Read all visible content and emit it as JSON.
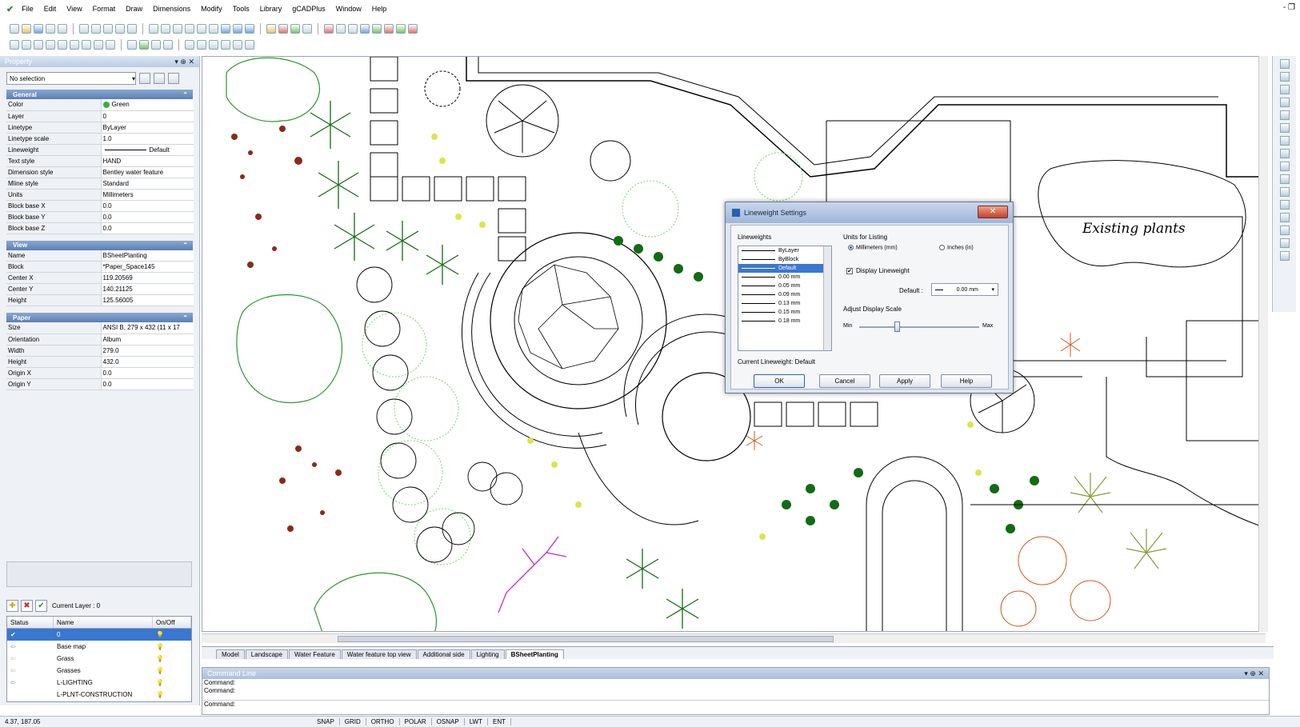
{
  "menu": {
    "items": [
      "File",
      "Edit",
      "View",
      "Format",
      "Draw",
      "Dimensions",
      "Modify",
      "Tools",
      "Library",
      "gCADPlus",
      "Window",
      "Help"
    ],
    "window_controls": "- ❐"
  },
  "property_panel": {
    "title": "Property",
    "title_controls": "▾ ⊕ ✕",
    "selection": "No selection",
    "general": {
      "header": "General",
      "rows": [
        {
          "k": "Color",
          "v": "Green"
        },
        {
          "k": "Layer",
          "v": "0"
        },
        {
          "k": "Linetype",
          "v": "ByLayer"
        },
        {
          "k": "Linetype scale",
          "v": "1.0"
        },
        {
          "k": "Lineweight",
          "v": "Default"
        },
        {
          "k": "Text style",
          "v": "HAND"
        },
        {
          "k": "Dimension style",
          "v": "Bentley water feature"
        },
        {
          "k": "Mline style",
          "v": "Standard"
        },
        {
          "k": "Units",
          "v": "Millimeters"
        },
        {
          "k": "Block base X",
          "v": "0.0"
        },
        {
          "k": "Block base Y",
          "v": "0.0"
        },
        {
          "k": "Block base Z",
          "v": "0.0"
        }
      ]
    },
    "view": {
      "header": "View",
      "rows": [
        {
          "k": "Name",
          "v": "BSheetPlanting"
        },
        {
          "k": "Block",
          "v": "*Paper_Space145"
        },
        {
          "k": "Center X",
          "v": "119.20569"
        },
        {
          "k": "Center Y",
          "v": "140.21125"
        },
        {
          "k": "Height",
          "v": "125.56005"
        }
      ]
    },
    "paper": {
      "header": "Paper",
      "rows": [
        {
          "k": "Size",
          "v": "ANSI B, 279 x 432 (11 x 17"
        },
        {
          "k": "Orientation",
          "v": "Album"
        },
        {
          "k": "Width",
          "v": "279.0"
        },
        {
          "k": "Height",
          "v": "432.0"
        },
        {
          "k": "Origin X",
          "v": "0.0"
        },
        {
          "k": "Origin Y",
          "v": "0.0"
        }
      ]
    }
  },
  "layers": {
    "current_layer_label": "Current Layer : 0",
    "columns": [
      "Status",
      "Name",
      "On/Off"
    ],
    "rows": [
      {
        "status": "✔",
        "name": "0",
        "selected": true
      },
      {
        "status": "",
        "name": "Base map",
        "selected": false
      },
      {
        "status": "",
        "name": "Grass",
        "selected": false
      },
      {
        "status": "",
        "name": "Grasses",
        "selected": false
      },
      {
        "status": "",
        "name": "L-LIGHTING",
        "selected": false
      },
      {
        "status": "",
        "name": "L-PLNT-CONSTRUCTION",
        "selected": false
      }
    ]
  },
  "drawing": {
    "label_existing_plants": "Existing plants"
  },
  "layout_tabs": [
    "Model",
    "Landscape",
    "Water Feature",
    "Water feature top view",
    "Additional side",
    "Lighting",
    "BSheetPlanting"
  ],
  "active_tab": "BSheetPlanting",
  "command": {
    "title": "Command Line",
    "title_controls": "▾ ⊕ ✕",
    "lines": [
      "Command:",
      "Command:"
    ],
    "prompt": "Command:"
  },
  "status": {
    "coords": "4.37, 187.05",
    "buttons": [
      "SNAP",
      "GRID",
      "ORTHO",
      "POLAR",
      "OSNAP",
      "LWT",
      "ENT"
    ]
  },
  "dialog": {
    "title": "Lineweight Settings",
    "close": "✕",
    "lineweights_label": "Lineweights",
    "lineweights": [
      "ByLayer",
      "ByBlock",
      "Default",
      "0.00 mm",
      "0.05 mm",
      "0.09 mm",
      "0.13 mm",
      "0.15 mm",
      "0.18 mm"
    ],
    "selected_lineweight": "Default",
    "units_label": "Units for Listing",
    "unit_mm": "Millimeters (mm)",
    "unit_in": "Inches (in)",
    "display_lineweight": "Display Lineweight",
    "default_label": "Default :",
    "default_value": "0.00 mm",
    "adjust_label": "Adjust Display Scale",
    "min": "Min",
    "max": "Max",
    "current_label": "Current Lineweight:",
    "current_value": "Default",
    "ok": "OK",
    "cancel": "Cancel",
    "apply": "Apply",
    "help": "Help"
  },
  "colors": {
    "accent": "#3a77d0",
    "close_red": "#c6402a",
    "plant_green": "#2a9a2a",
    "dialog_bg": "#dfe6ef"
  }
}
